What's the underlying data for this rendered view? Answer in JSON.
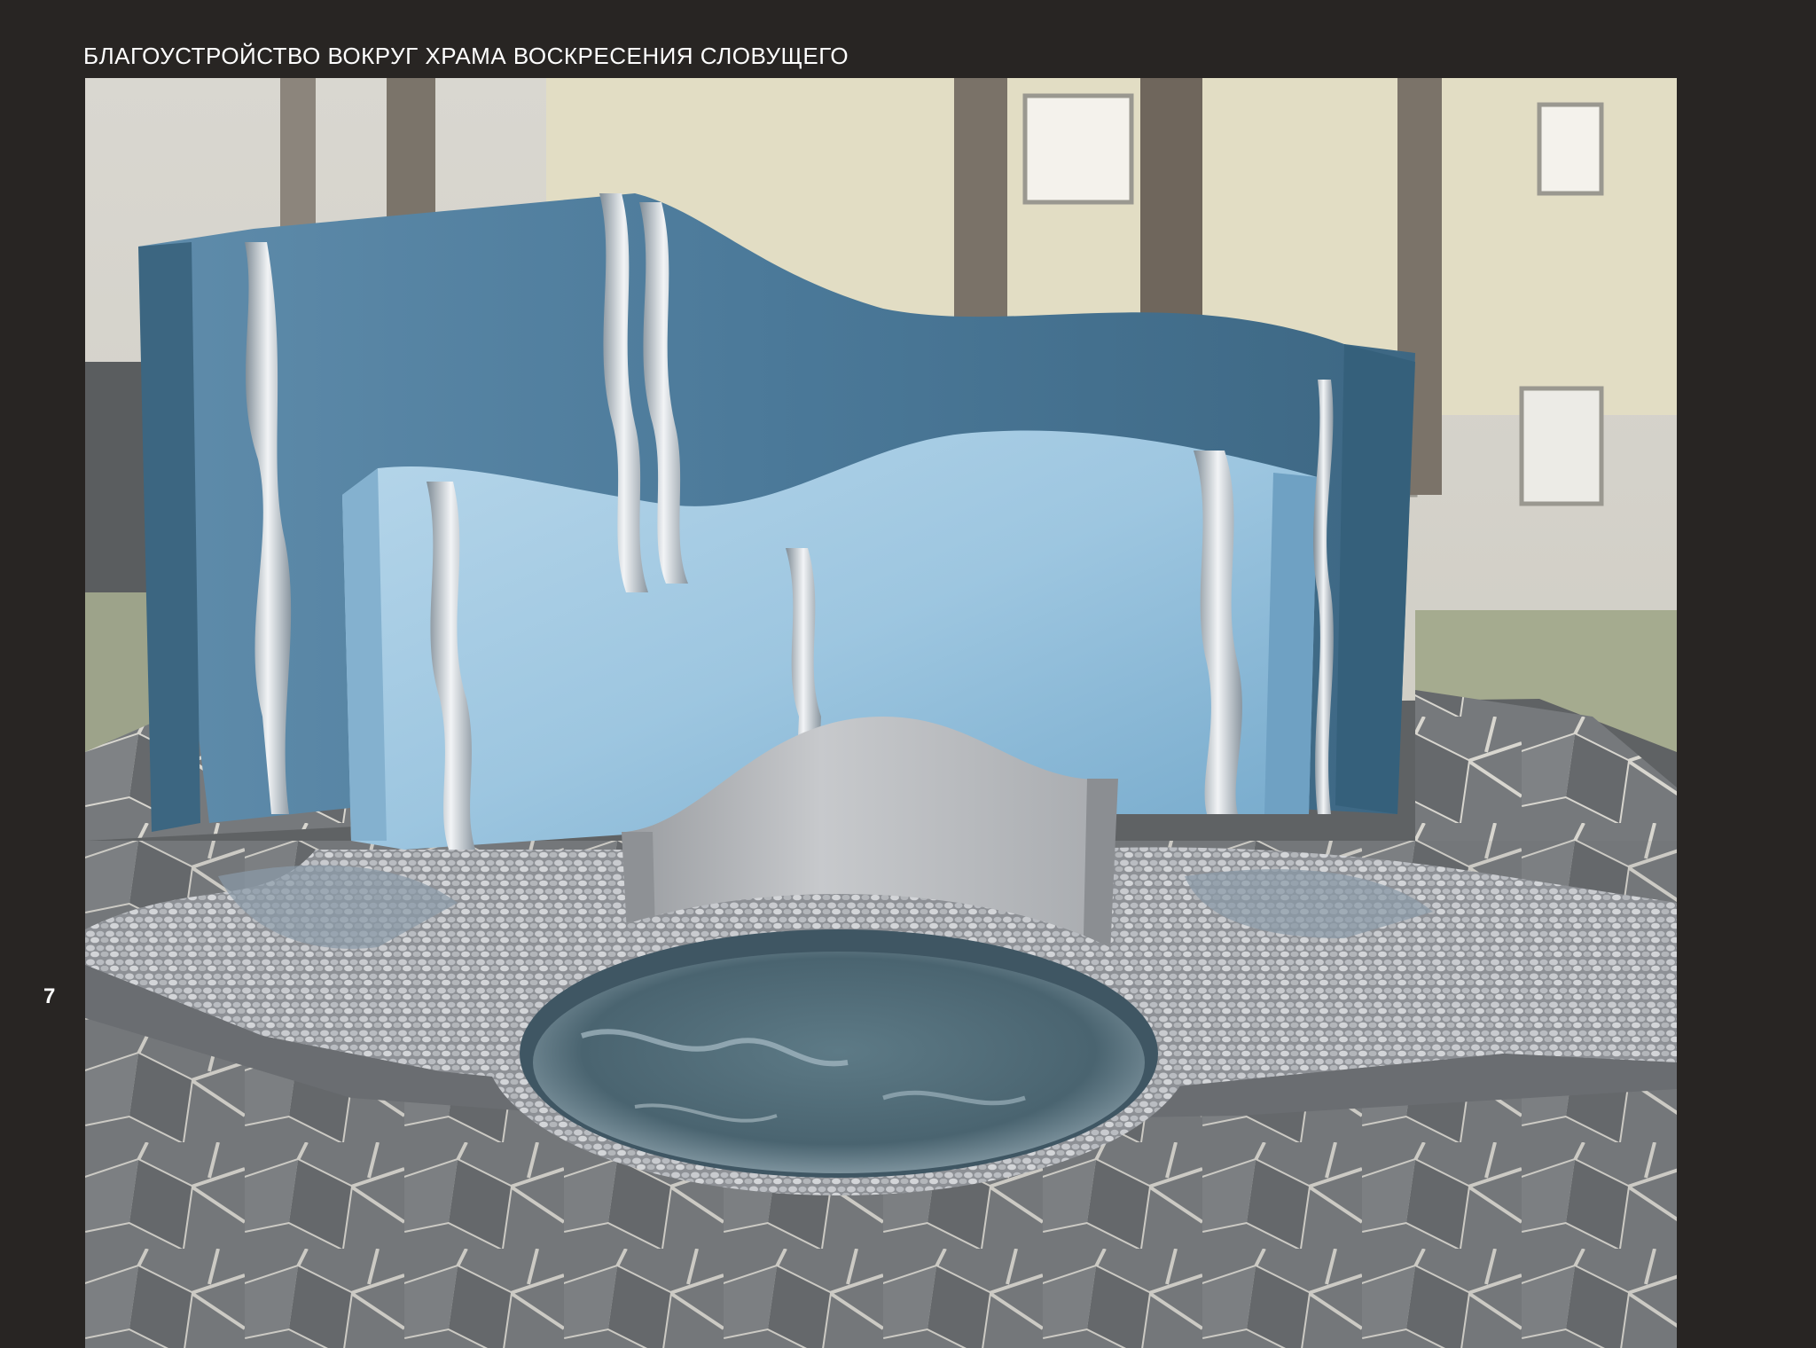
{
  "page": {
    "title": "БЛАГОУСТРОЙСТВО ВОКРУГ ХРАМА ВОСКРЕСЕНИЯ СЛОВУЩЕГО",
    "page_number": "7"
  },
  "colors": {
    "background": "#282523",
    "text": "#ffffff",
    "panel_blue_dark": "#4d7a99",
    "panel_blue_light": "#8fbfdc",
    "panel_silver": "#b5b8bb",
    "water": "#56707c",
    "paving": "#6f7274",
    "pebble": "#a7a9ad"
  }
}
